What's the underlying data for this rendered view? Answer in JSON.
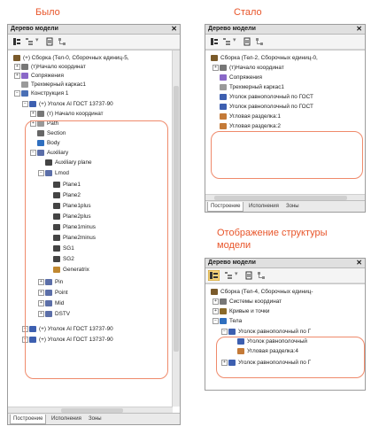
{
  "captions": {
    "before": "Было",
    "after": "Стало",
    "structure_line1": "Отображение структуры",
    "structure_line2": "модели"
  },
  "colors": {
    "caption": "#e8552a",
    "highlight_oval": "#ef8a6b"
  },
  "panel_title": "Дерево модели",
  "tabs": [
    "Построение",
    "Исполнения",
    "Зоны"
  ],
  "left_tree": [
    {
      "label": "(+) Сборка (Тел-0, Сборочных единиц-5,",
      "icon": "assembly-icon"
    },
    {
      "label": "(т)Начало координат",
      "icon": "origin-icon"
    },
    {
      "label": "Сопряжения",
      "icon": "mates-icon"
    },
    {
      "label": "Трехмерный каркас1",
      "icon": "wireframe-icon"
    },
    {
      "label": "Конструкция 1",
      "icon": "construction-icon"
    },
    {
      "label": "(+) Уголок Al ГОСТ 13737-90",
      "icon": "part-icon"
    },
    {
      "label": "(т) Начало координат",
      "icon": "origin-icon"
    },
    {
      "label": "Path",
      "icon": "path-icon"
    },
    {
      "label": "Section",
      "icon": "section-icon"
    },
    {
      "label": "Body",
      "icon": "body-icon"
    },
    {
      "label": "Auxiliary",
      "icon": "folder-icon"
    },
    {
      "label": "Auxiliary plane",
      "icon": "plane-icon"
    },
    {
      "label": "Lmod",
      "icon": "folder-icon"
    },
    {
      "label": "Plane1",
      "icon": "plane-icon"
    },
    {
      "label": "Plane2",
      "icon": "plane-icon"
    },
    {
      "label": "Plane1plus",
      "icon": "plane-icon"
    },
    {
      "label": "Plane2plus",
      "icon": "plane-icon"
    },
    {
      "label": "Plane1minus",
      "icon": "plane-icon"
    },
    {
      "label": "Plane2minus",
      "icon": "plane-icon"
    },
    {
      "label": "SG1",
      "icon": "plane-icon"
    },
    {
      "label": "SG2",
      "icon": "plane-icon"
    },
    {
      "label": "Generatrix",
      "icon": "line-icon"
    },
    {
      "label": "Pin",
      "icon": "folder-icon"
    },
    {
      "label": "Point",
      "icon": "folder-icon"
    },
    {
      "label": "Mid",
      "icon": "folder-icon"
    },
    {
      "label": "DSTV",
      "icon": "folder-icon"
    },
    {
      "label": "(+) Уголок Al ГОСТ 13737-90",
      "icon": "part-icon"
    },
    {
      "label": "(+) Уголок Al ГОСТ 13737-90",
      "icon": "part-icon"
    }
  ],
  "right_top_tree": [
    {
      "label": "Сборка (Тел-2, Сборочных единиц-0,",
      "icon": "assembly-icon"
    },
    {
      "label": "(т)Начало координат",
      "icon": "origin-icon"
    },
    {
      "label": "Сопряжения",
      "icon": "mates-icon"
    },
    {
      "label": "Трехмерный каркас1",
      "icon": "wireframe-icon"
    },
    {
      "label": "Уголок равнополочный по ГОСТ",
      "icon": "part-icon"
    },
    {
      "label": "Уголок равнополочный по ГОСТ",
      "icon": "part-icon"
    },
    {
      "label": "Угловая разделка:1",
      "icon": "corner-icon"
    },
    {
      "label": "Угловая разделка:2",
      "icon": "corner-icon"
    }
  ],
  "right_bottom_tree": [
    {
      "label": "Сборка (Тел-4, Сборочных единиц-",
      "icon": "assembly-icon"
    },
    {
      "label": "Системы координат",
      "icon": "coordsys-icon"
    },
    {
      "label": "Кривые и точки",
      "icon": "curves-icon"
    },
    {
      "label": "Тела",
      "icon": "bodies-icon"
    },
    {
      "label": "Уголок равнополочный по Г",
      "icon": "part-icon"
    },
    {
      "label": "Уголок равнополочный",
      "icon": "part-icon"
    },
    {
      "label": "Угловая разделка:4",
      "icon": "corner-icon"
    },
    {
      "label": "Уголок равнополочный по Г",
      "icon": "part-icon"
    }
  ]
}
